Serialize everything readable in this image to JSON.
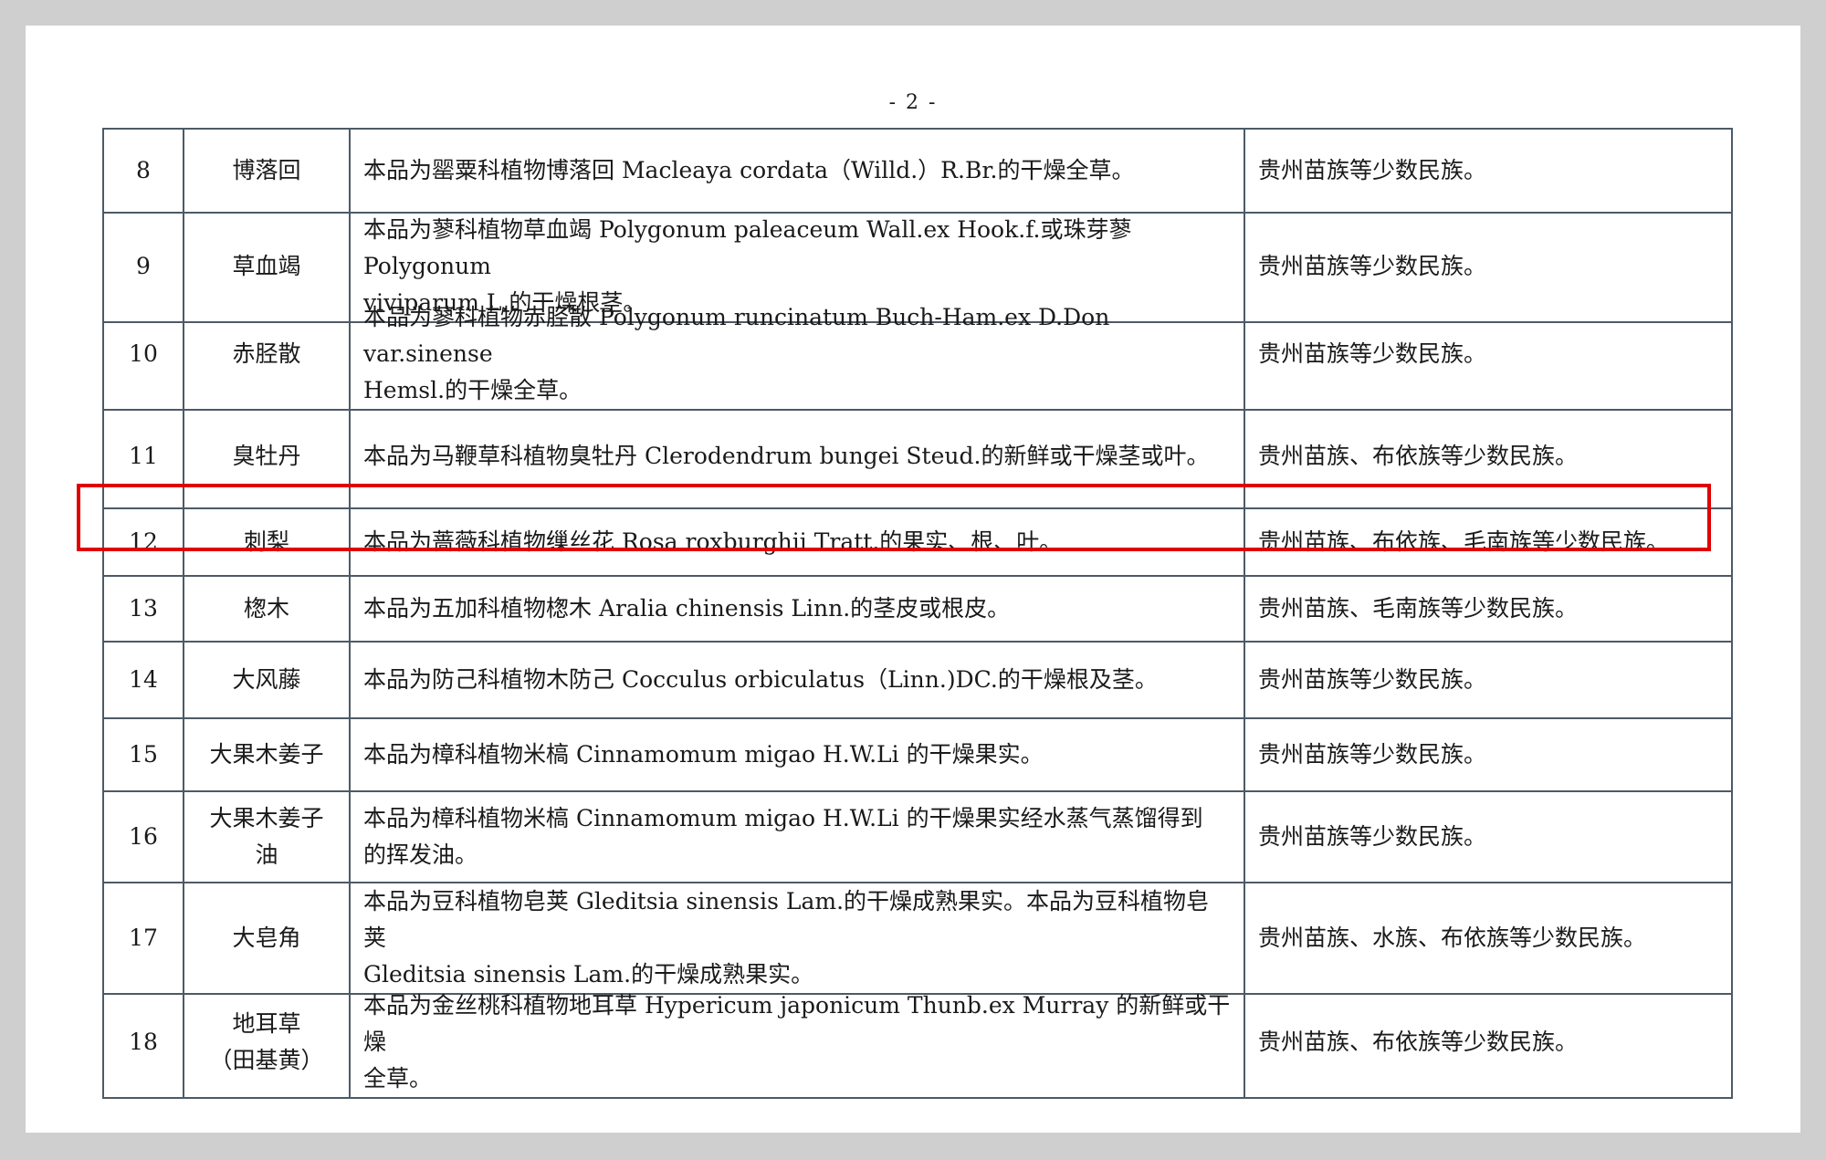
{
  "page_number": "- 2 -",
  "rows": [
    {
      "no": "8",
      "name": "博落回",
      "desc": "本品为罂粟科植物博落回 Macleaya cordata（Willd.）R.Br.的干燥全草。",
      "region": "贵州苗族等少数民族。"
    },
    {
      "no": "9",
      "name": "草血竭",
      "desc": "本品为蓼科植物草血竭 Polygonum paleaceum Wall.ex Hook.f.或珠芽蓼 Polygonum\nviviparum L.的干燥根茎。",
      "region": "贵州苗族等少数民族。"
    },
    {
      "no": "10",
      "name": "赤胫散",
      "desc": "本品为蓼科植物赤胫散 Polygonum runcinatum Buch-Ham.ex D.Don var.sinense\nHemsl.的干燥全草。",
      "region": "贵州苗族等少数民族。"
    },
    {
      "no": "11",
      "name": "臭牡丹",
      "desc": "本品为马鞭草科植物臭牡丹 Clerodendrum bungei Steud.的新鲜或干燥茎或叶。",
      "region": "贵州苗族、布依族等少数民族。"
    },
    {
      "no": "12",
      "name": "刺梨",
      "desc": "本品为蔷薇科植物缫丝花 Rosa roxburghii Tratt.的果实、根、叶。",
      "region": "贵州苗族、布依族、毛南族等少数民族。"
    },
    {
      "no": "13",
      "name": "楤木",
      "desc": "本品为五加科植物楤木 Aralia chinensis Linn.的茎皮或根皮。",
      "region": "贵州苗族、毛南族等少数民族。"
    },
    {
      "no": "14",
      "name": "大风藤",
      "desc": "本品为防己科植物木防己 Cocculus orbiculatus（Linn.)DC.的干燥根及茎。",
      "region": "贵州苗族等少数民族。"
    },
    {
      "no": "15",
      "name": "大果木姜子",
      "desc": "本品为樟科植物米槁 Cinnamomum migao H.W.Li 的干燥果实。",
      "region": "贵州苗族等少数民族。"
    },
    {
      "no": "16",
      "name": "大果木姜子\n油",
      "desc": "本品为樟科植物米槁 Cinnamomum migao H.W.Li 的干燥果实经水蒸气蒸馏得到\n的挥发油。",
      "region": "贵州苗族等少数民族。"
    },
    {
      "no": "17",
      "name": "大皂角",
      "desc": "本品为豆科植物皂荚 Gleditsia sinensis Lam.的干燥成熟果实。本品为豆科植物皂荚\nGleditsia sinensis Lam.的干燥成熟果实。",
      "region": "贵州苗族、水族、布依族等少数民族。"
    },
    {
      "no": "18",
      "name": "地耳草\n（田基黄）",
      "desc": "本品为金丝桃科植物地耳草 Hypericum japonicum Thunb.ex Murray 的新鲜或干燥\n全草。",
      "region": "贵州苗族、布依族等少数民族。"
    }
  ],
  "highlighted_row": "12",
  "colors": {
    "highlight": "#e00000",
    "grid": "#4d5a66"
  }
}
